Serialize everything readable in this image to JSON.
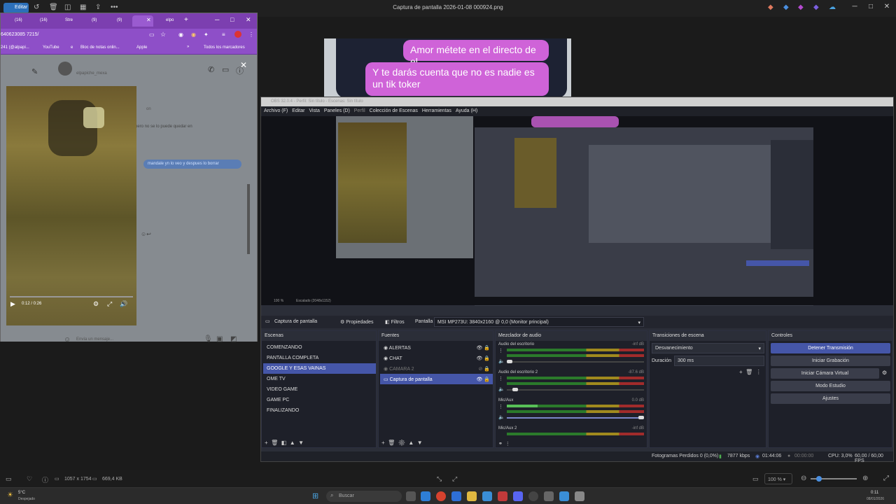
{
  "viewer": {
    "title": "Captura de pantalla 2026-01-08 000924.png",
    "edit_label": "Editar",
    "dimensions": "1057 x 1754",
    "file_size": "669,4 KB",
    "zoom": "100 %",
    "window_min": "─",
    "window_max": "□",
    "window_close": "✕"
  },
  "phone_chat": {
    "message1": "Amor métete en el directo de el",
    "message2": "Y te darás cuenta que no es nadie es un tik toker"
  },
  "chrome": {
    "tabs": [
      "(16)",
      "(16)",
      "Stre",
      "(9)",
      "(9)",
      "",
      "elpo"
    ],
    "url": "640623085 7215/",
    "bookmarks": [
      "241 (@alpapi...",
      "YouTube",
      "e",
      "Bloc de notas onlin...",
      "Apple",
      "Todos los marcadores"
    ],
    "chat_name": "elpapiche_mexa",
    "chat_msg1": "on",
    "chat_msg2": "pero no se lo puede quedar en",
    "chat_reply": "mandale yn lo veo y despues lo borrar",
    "video_time": "0:12 / 0:26",
    "message_placeholder": "Envía un mensaje..."
  },
  "obs": {
    "title": "OBS 32.0.4 - Perfil: Sin título - Escenas: Sin título",
    "menu": [
      "Archivo (F)",
      "Editar",
      "Vista",
      "Paneles (D)",
      "Perfil",
      "Colección de Escenas",
      "Herramientas",
      "Ayuda (H)"
    ],
    "preview_zoom": "100 %",
    "preview_scale": "Escalado (2048x1152)",
    "source_toolbar": {
      "source_name": "Captura de pantalla",
      "properties": "Propiedades",
      "filters": "Filtros",
      "screen_label": "Pantalla",
      "screen_value": "MSI MP273U: 3840x2160 @ 0,0 (Monitor principal)"
    },
    "scenes": {
      "header": "Escenas",
      "items": [
        "COMENZANDO",
        "PANTALLA COMPLETA",
        "GOOGLE Y ESAS VAINAS",
        "OME TV",
        "VIDEO  GAME",
        "GAME PC",
        "FINALIZANDO"
      ],
      "selected": 2
    },
    "sources": {
      "header": "Fuentes",
      "items": [
        "ALERTAS",
        "CHAT",
        "CAMARA 2",
        "Captura de pantalla"
      ],
      "selected": 3
    },
    "mixer": {
      "header": "Mezclador de audio",
      "channels": [
        {
          "name": "Audio del escritorio",
          "db": "-inf dB"
        },
        {
          "name": "Audio del escritorio 2",
          "db": "-87.6 dB"
        },
        {
          "name": "Mic/Aux",
          "db": "0.0 dB"
        },
        {
          "name": "Mic/Aux 2",
          "db": "-inf dB"
        }
      ],
      "ticks": [
        "-60",
        "-55",
        "-50",
        "-45",
        "-40",
        "-35",
        "-30",
        "-25",
        "-20",
        "-15",
        "-10",
        "-5",
        "0"
      ]
    },
    "transitions": {
      "header": "Transiciones de escena",
      "selected": "Desvanecimiento",
      "duration_label": "Duración",
      "duration_value": "300 ms"
    },
    "controls": {
      "header": "Controles",
      "buttons": [
        "Detener Transmisión",
        "Iniciar Grabación",
        "Iniciar Cámara Virtual",
        "Modo Estudio",
        "Ajustes"
      ]
    },
    "status": {
      "dropped": "Fotogramas Perdidos 0 (0,0%)",
      "bitrate": "7877 kbps",
      "stream_time": "01:44:06",
      "rec_time": "00:00:00",
      "cpu": "CPU: 3,0%",
      "fps": "60,00 / 60,00 FPS"
    }
  },
  "taskbar": {
    "weather_temp": "5°C",
    "weather_desc": "Despejado",
    "search": "Buscar",
    "time": "0:11",
    "date": "08/01/2026"
  }
}
